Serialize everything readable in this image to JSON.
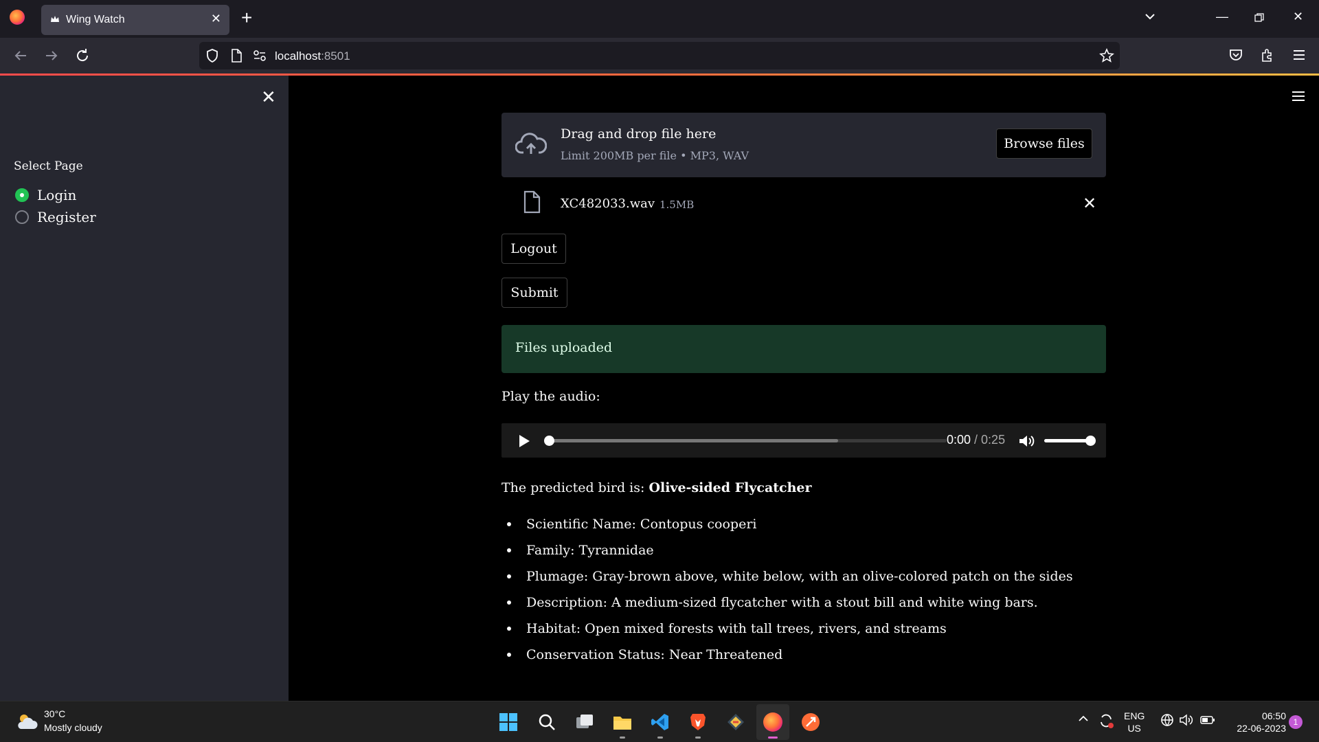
{
  "browser": {
    "tab_title": "Wing Watch",
    "url_host": "localhost",
    "url_port": ":8501"
  },
  "sidebar": {
    "label": "Select Page",
    "options": [
      {
        "label": "Login",
        "selected": true
      },
      {
        "label": "Register",
        "selected": false
      }
    ]
  },
  "uploader": {
    "title": "Drag and drop file here",
    "subtitle": "Limit 200MB per file • MP3, WAV",
    "browse_label": "Browse files",
    "file_name": "XC482033.wav",
    "file_size": "1.5MB"
  },
  "buttons": {
    "logout": "Logout",
    "submit": "Submit"
  },
  "alert": {
    "text": "Files uploaded",
    "color": "#173928"
  },
  "audio": {
    "label": "Play the audio:",
    "current": "0:00",
    "duration": " / 0:25",
    "progress": 0.0,
    "buffered": 0.73,
    "volume": 1.0
  },
  "prediction": {
    "prefix": "The predicted bird is: ",
    "bird": "Olive-sided Flycatcher"
  },
  "facts": [
    "Scientific Name: Contopus cooperi",
    "Family: Tyrannidae",
    "Plumage: Gray-brown above, white below, with an olive-colored patch on the sides",
    "Description: A medium-sized flycatcher with a stout bill and white wing bars.",
    "Habitat: Open mixed forests with tall trees, rivers, and streams",
    "Conservation Status: Near Threatened"
  ],
  "taskbar": {
    "temp": "30°C",
    "condition": "Mostly cloudy",
    "lang_line1": "ENG",
    "lang_line2": "US",
    "time": "06:50",
    "date": "22-06-2023",
    "notification_count": "1",
    "apps": [
      "start-icon",
      "search-icon",
      "task-view-icon",
      "file-explorer-icon",
      "vscode-icon",
      "brave-icon",
      "git-icon",
      "firefox-icon",
      "postman-icon"
    ]
  },
  "colors": {
    "accent_radio": "#21c354",
    "sidebar_bg": "#262730",
    "main_bg": "#000000"
  }
}
